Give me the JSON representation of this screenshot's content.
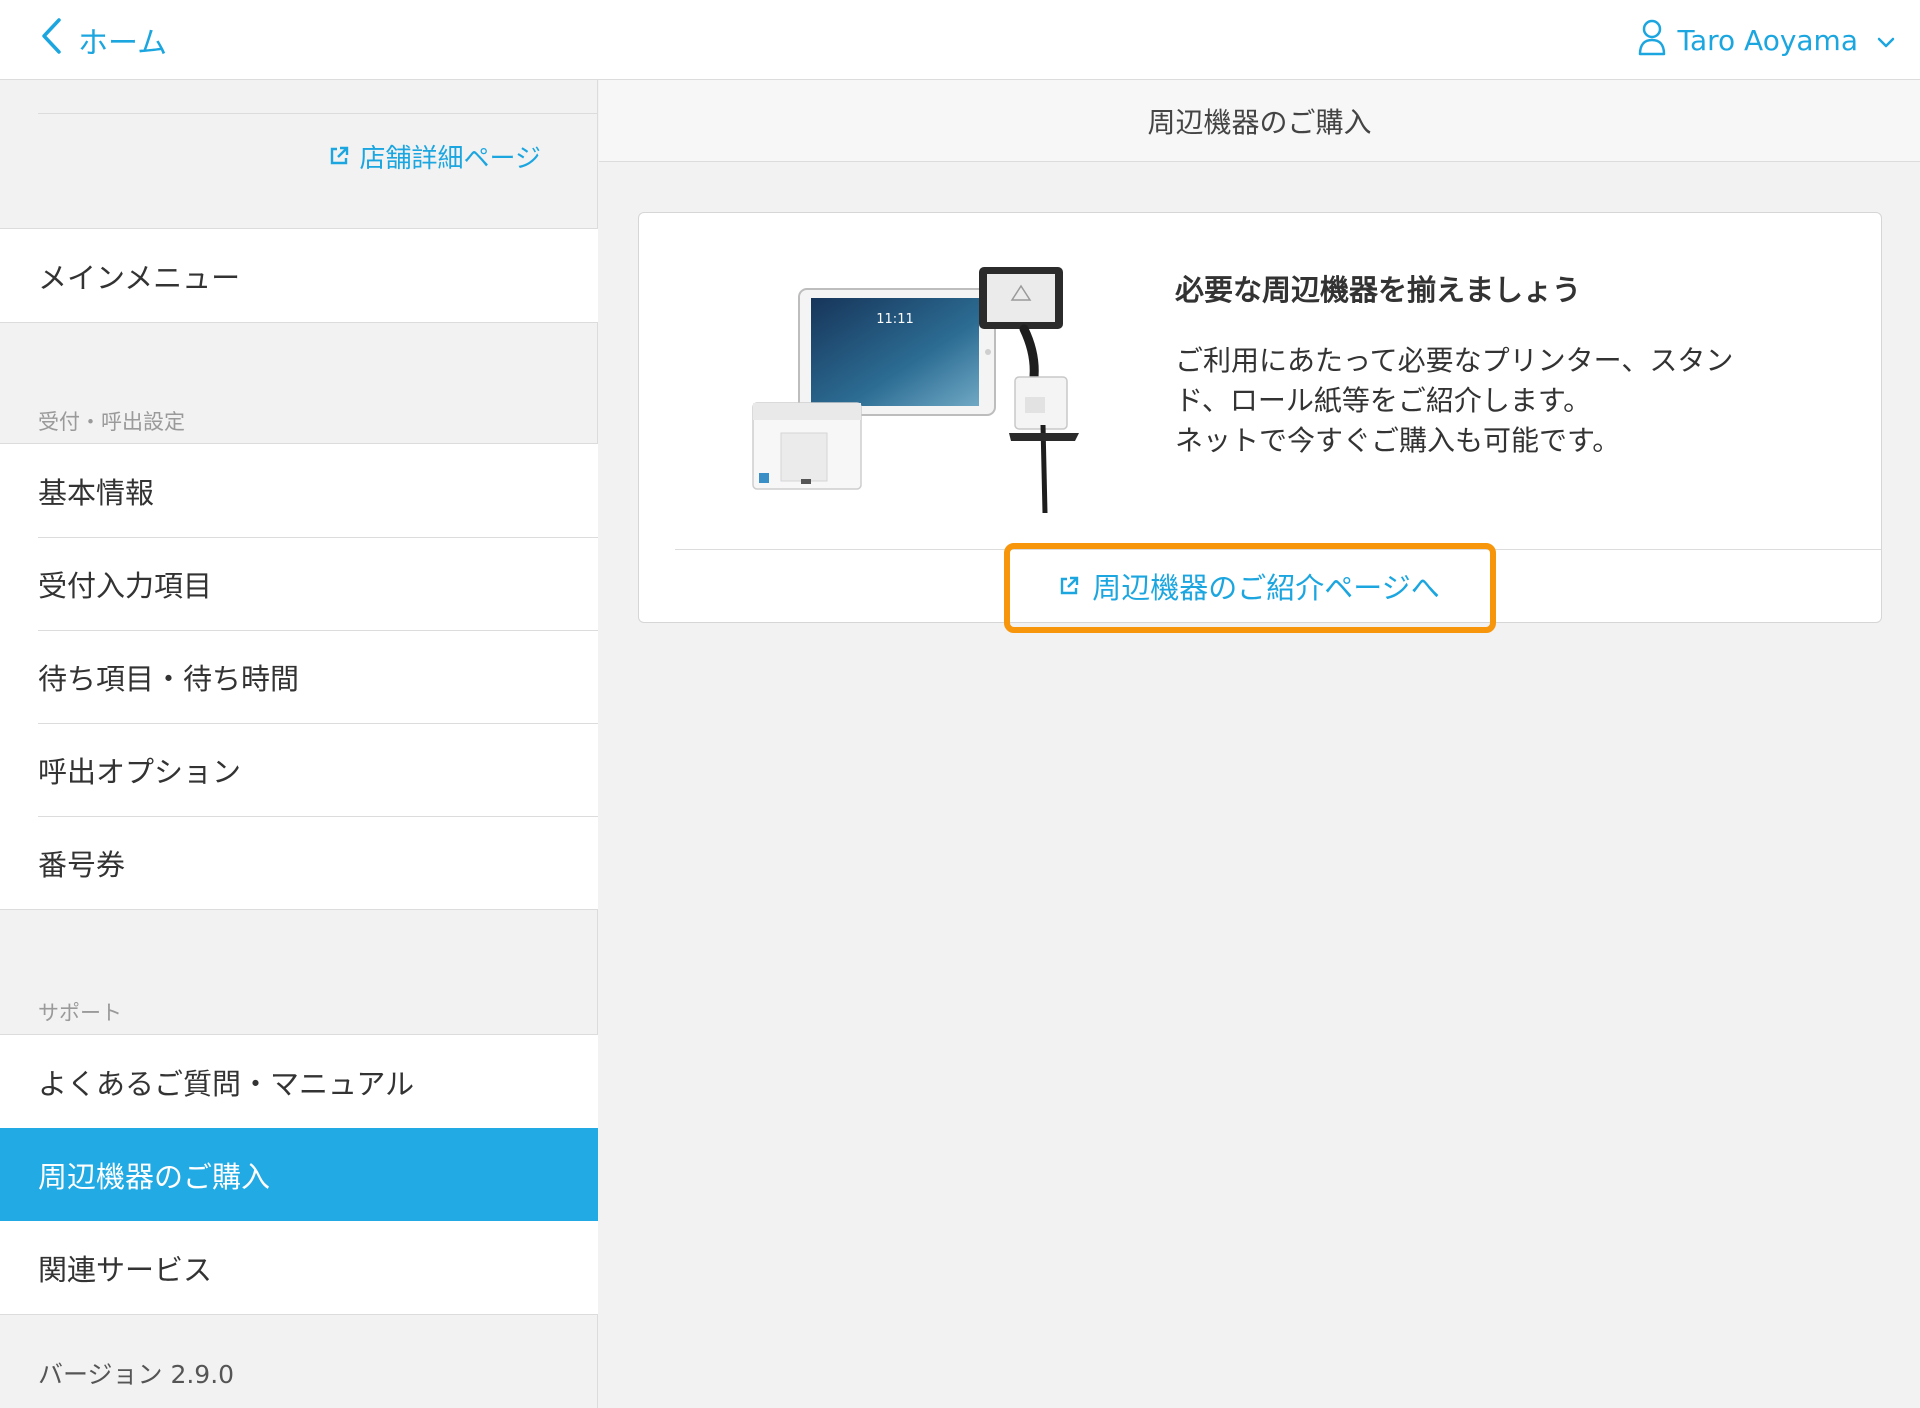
{
  "header": {
    "back_label": "ホーム",
    "user_name": "Taro Aoyama"
  },
  "sidebar": {
    "store_link_label": "店舗詳細ページ",
    "main_menu": [
      "メインメニュー"
    ],
    "section_reception": "受付・呼出設定",
    "reception_items": [
      "基本情報",
      "受付入力項目",
      "待ち項目・待ち時間",
      "呼出オプション",
      "番号券"
    ],
    "section_support": "サポート",
    "support_items": [
      "よくあるご質問・マニュアル",
      "周辺機器のご購入",
      "関連サービス"
    ],
    "active_item": "周辺機器のご購入",
    "version": "バージョン 2.9.0"
  },
  "main": {
    "title": "周辺機器のご購入",
    "card": {
      "image_time": "11:11",
      "heading": "必要な周辺機器を揃えましょう",
      "description_lines": [
        "ご利用にあたって必要なプリンター、スタン",
        "ド、ロール紙等をご紹介します。",
        "ネットで今すぐご購入も可能です。"
      ],
      "link_label": "周辺機器のご紹介ページへ"
    }
  },
  "colors": {
    "accent": "#1ca6e0",
    "active_bg": "#21aae3",
    "highlight": "#f7950b"
  }
}
